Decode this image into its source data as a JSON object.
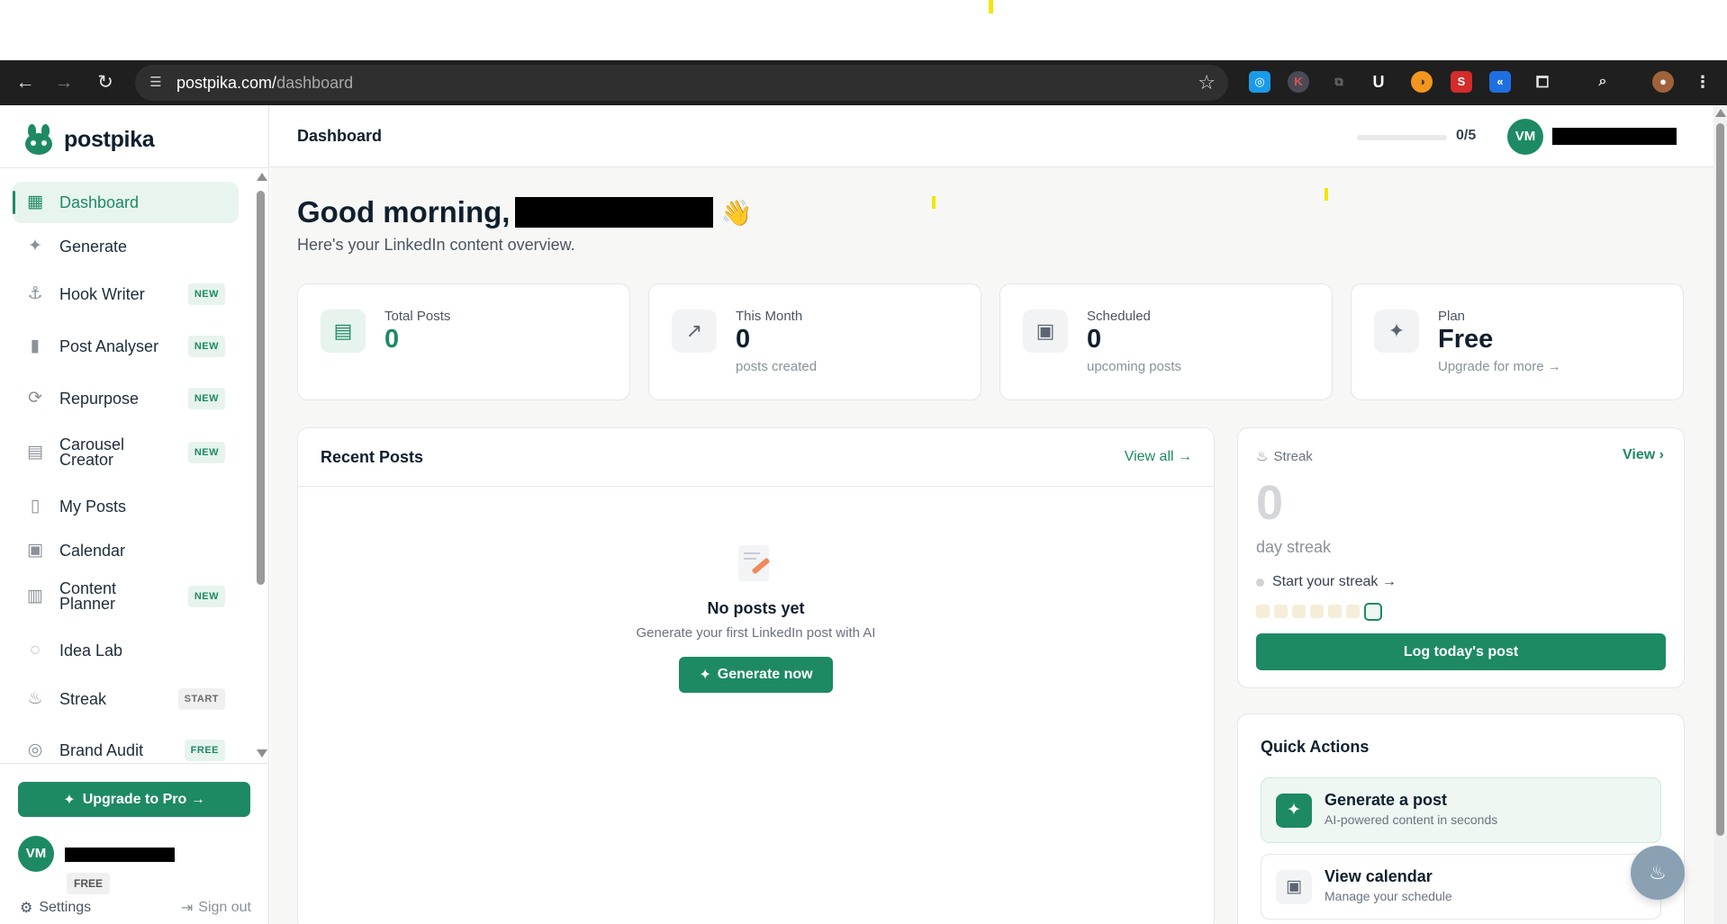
{
  "browser": {
    "url_host": "postpika.com/",
    "url_path": "dashboard",
    "extensions": [
      "extension-blue-icon",
      "extension-k-icon",
      "extension-copy-icon",
      "extension-u-icon",
      "extension-orange-icon",
      "extension-s-icon",
      "extension-rewind-icon",
      "extensions-puzzle-icon",
      "tab-search-icon",
      "profile-avatar-icon"
    ]
  },
  "brand": {
    "name": "postpika"
  },
  "sidebar": {
    "items": [
      {
        "label": "Dashboard",
        "icon": "grid-icon",
        "badge": ""
      },
      {
        "label": "Generate",
        "icon": "sparkles-icon",
        "badge": ""
      },
      {
        "label": "Hook Writer",
        "icon": "anchor-icon",
        "badge": "NEW"
      },
      {
        "label": "Post Analyser",
        "icon": "bar-chart-icon",
        "badge": "NEW"
      },
      {
        "label": "Repurpose",
        "icon": "refresh-icon",
        "badge": "NEW"
      },
      {
        "label": "Carousel Creator",
        "icon": "layout-icon",
        "badge": "NEW"
      },
      {
        "label": "My Posts",
        "icon": "document-icon",
        "badge": ""
      },
      {
        "label": "Calendar",
        "icon": "calendar-icon",
        "badge": ""
      },
      {
        "label": "Content Planner",
        "icon": "planner-icon",
        "badge": "NEW"
      },
      {
        "label": "Idea Lab",
        "icon": "lightbulb-icon",
        "badge": ""
      },
      {
        "label": "Streak",
        "icon": "flame-icon",
        "badge": "START"
      },
      {
        "label": "Brand Audit",
        "icon": "target-icon",
        "badge": "FREE"
      }
    ],
    "upgrade_label": "Upgrade to Pro →",
    "user_initials": "VM",
    "plan_badge": "FREE",
    "settings_label": "Settings",
    "signout_label": "Sign out"
  },
  "header": {
    "title": "Dashboard",
    "usage_text": "0/5",
    "usage_fraction": 0,
    "user_initials": "VM"
  },
  "greeting": {
    "text": "Good morning,",
    "emoji": "👋",
    "subtitle": "Here's your LinkedIn content overview."
  },
  "stats": [
    {
      "label": "Total Posts",
      "value": "0",
      "sub": "",
      "icon": "document-icon"
    },
    {
      "label": "This Month",
      "value": "0",
      "sub": "posts created",
      "icon": "trending-up-icon"
    },
    {
      "label": "Scheduled",
      "value": "0",
      "sub": "upcoming posts",
      "icon": "calendar-icon"
    },
    {
      "label": "Plan",
      "value": "Free",
      "sub": "Upgrade for more →",
      "icon": "sparkles-icon"
    }
  ],
  "recent_posts": {
    "title": "Recent Posts",
    "view_all": "View all →",
    "empty_title": "No posts yet",
    "empty_sub": "Generate your first LinkedIn post with AI",
    "cta": "Generate now"
  },
  "streak": {
    "label": "Streak",
    "view": "View ›",
    "count": "0",
    "unit": "day streak",
    "start": "Start your streak →",
    "days_shown": 7,
    "log_button": "Log today's post"
  },
  "quick_actions": {
    "title": "Quick Actions",
    "items": [
      {
        "title": "Generate a post",
        "sub": "AI-powered content in seconds",
        "icon": "sparkles-icon"
      },
      {
        "title": "View calendar",
        "sub": "Manage your schedule",
        "icon": "calendar-icon"
      }
    ]
  },
  "colors": {
    "accent": "#1d8a63",
    "accent_light": "#e8f5ef"
  }
}
